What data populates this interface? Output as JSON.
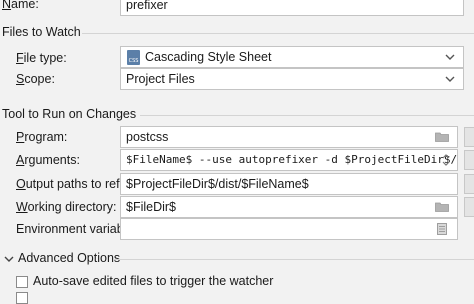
{
  "name": {
    "label_u": "N",
    "label_rest": "ame:",
    "value": "prefixer"
  },
  "files_to_watch": {
    "title": "Files to Watch",
    "file_type": {
      "label_u": "F",
      "label_rest": "ile type:",
      "value": "Cascading Style Sheet",
      "icon_text": "CSS"
    },
    "scope": {
      "label_u": "S",
      "label_rest": "cope:",
      "value": "Project Files"
    }
  },
  "tool": {
    "title": "Tool to Run on Changes",
    "program": {
      "label_u": "P",
      "label_rest": "rogram:",
      "value": "postcss"
    },
    "arguments": {
      "label_u": "A",
      "label_rest": "rguments:",
      "value": "$FileName$ --use autoprefixer -d $ProjectFileDir$/dist"
    },
    "output_paths": {
      "label_u": "O",
      "label_rest": "utput paths to refresh:",
      "value": "$ProjectFileDir$/dist/$FileName$"
    },
    "working_directory": {
      "label_u": "W",
      "label_rest": "orking directory:",
      "value": "$FileDir$"
    },
    "environment_variables": {
      "label": "Environment variables:",
      "value": ""
    }
  },
  "advanced": {
    "title": "Advanced Options",
    "auto_save": {
      "label": "Auto-save edited files to trigger the watcher",
      "checked": false
    }
  }
}
